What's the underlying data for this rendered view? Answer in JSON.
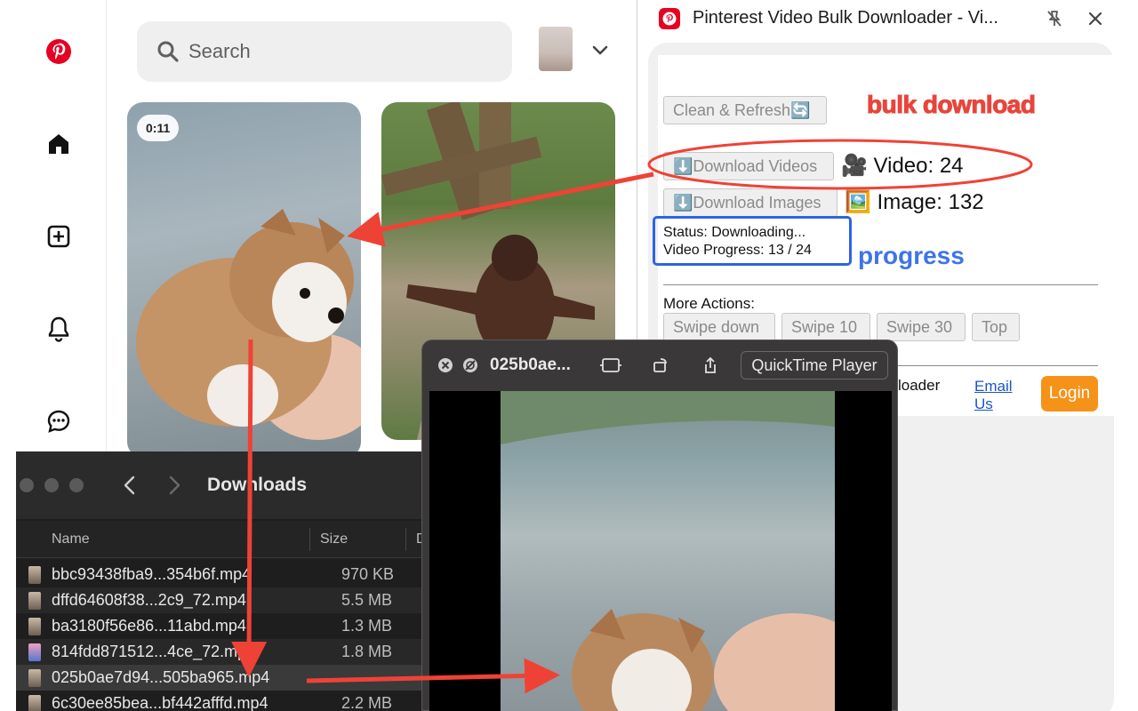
{
  "pinterest": {
    "search_placeholder": "Search",
    "pins": [
      {
        "duration": "0:11"
      },
      {
        "duration": ""
      }
    ]
  },
  "extension": {
    "title": "Pinterest Video Bulk Downloader - Vi...",
    "buttons": {
      "clean_refresh": "Clean & Refresh🔄",
      "download_videos": "⬇️Download Videos",
      "download_images": "⬇️Download Images",
      "swipe_down": "Swipe down",
      "swipe_10": "Swipe 10",
      "swipe_30": "Swipe 30",
      "top": "Top",
      "login": "Login"
    },
    "video_count_label": "🎥 Video: 24",
    "image_count_label": "🖼️ Image: 132",
    "status_line": "Status: Downloading...",
    "progress_line": "Video Progress: 13 / 24",
    "more_actions_label": "More Actions:",
    "footer_text": "loader",
    "email_link": "Email Us",
    "annotations": {
      "bulk": "bulk download",
      "progress": "progress"
    },
    "colors": {
      "accent_orange": "#f59218",
      "pinterest_red": "#e60023",
      "annotation_red": "#e8453c",
      "annotation_blue": "#3e74e8"
    }
  },
  "finder": {
    "title": "Downloads",
    "columns": {
      "name": "Name",
      "size": "Size",
      "date": "D"
    },
    "files": [
      {
        "name": "bbc93438fba9...354b6f.mp4",
        "size": "970 KB"
      },
      {
        "name": "dffd64608f38...2c9_72.mp4",
        "size": "5.5 MB"
      },
      {
        "name": "ba3180f56e86...11abd.mp4",
        "size": "1.3 MB"
      },
      {
        "name": "814fdd871512...4ce_72.mp4",
        "size": "1.8 MB"
      },
      {
        "name": "025b0ae7d94...505ba965.mp4",
        "size": ""
      },
      {
        "name": "6c30ee85bea...bf442afffd.mp4",
        "size": "2.2 MB"
      }
    ]
  },
  "quicktime": {
    "title": "025b0ae...",
    "app_button": "QuickTime Player"
  }
}
